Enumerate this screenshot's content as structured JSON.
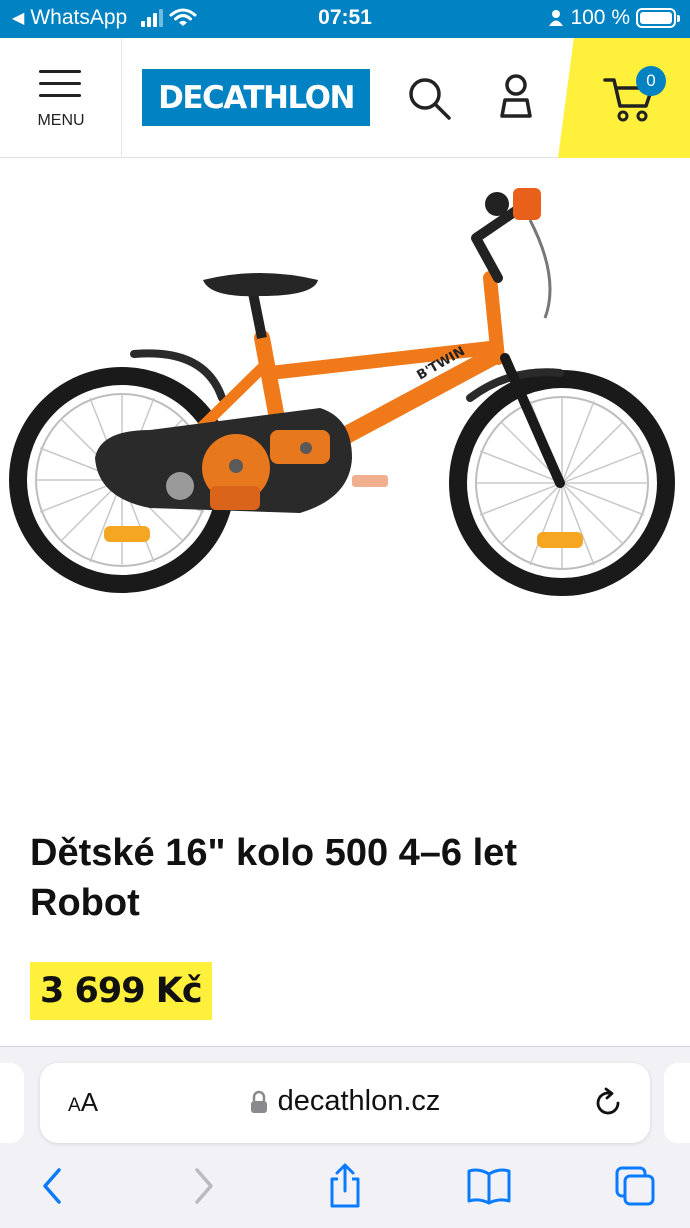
{
  "status_bar": {
    "back_app": "WhatsApp",
    "time": "07:51",
    "battery": "100 %",
    "battery_level": 1.0
  },
  "header": {
    "menu_label": "MENU",
    "logo_text": "DECATHLON",
    "cart_count": "0",
    "brand_color": "#0082c3",
    "accent_color": "#fff03c"
  },
  "product": {
    "title_line1": "Dětské 16\" kolo 500 4–6 let",
    "title_line2": "Robot",
    "price": "3 699 Kč",
    "image_alt_icon": "kids-bike-image",
    "frame_label": "B'TWIN"
  },
  "browser": {
    "aa_small": "A",
    "aa_large": "A",
    "url": "decathlon.cz"
  }
}
